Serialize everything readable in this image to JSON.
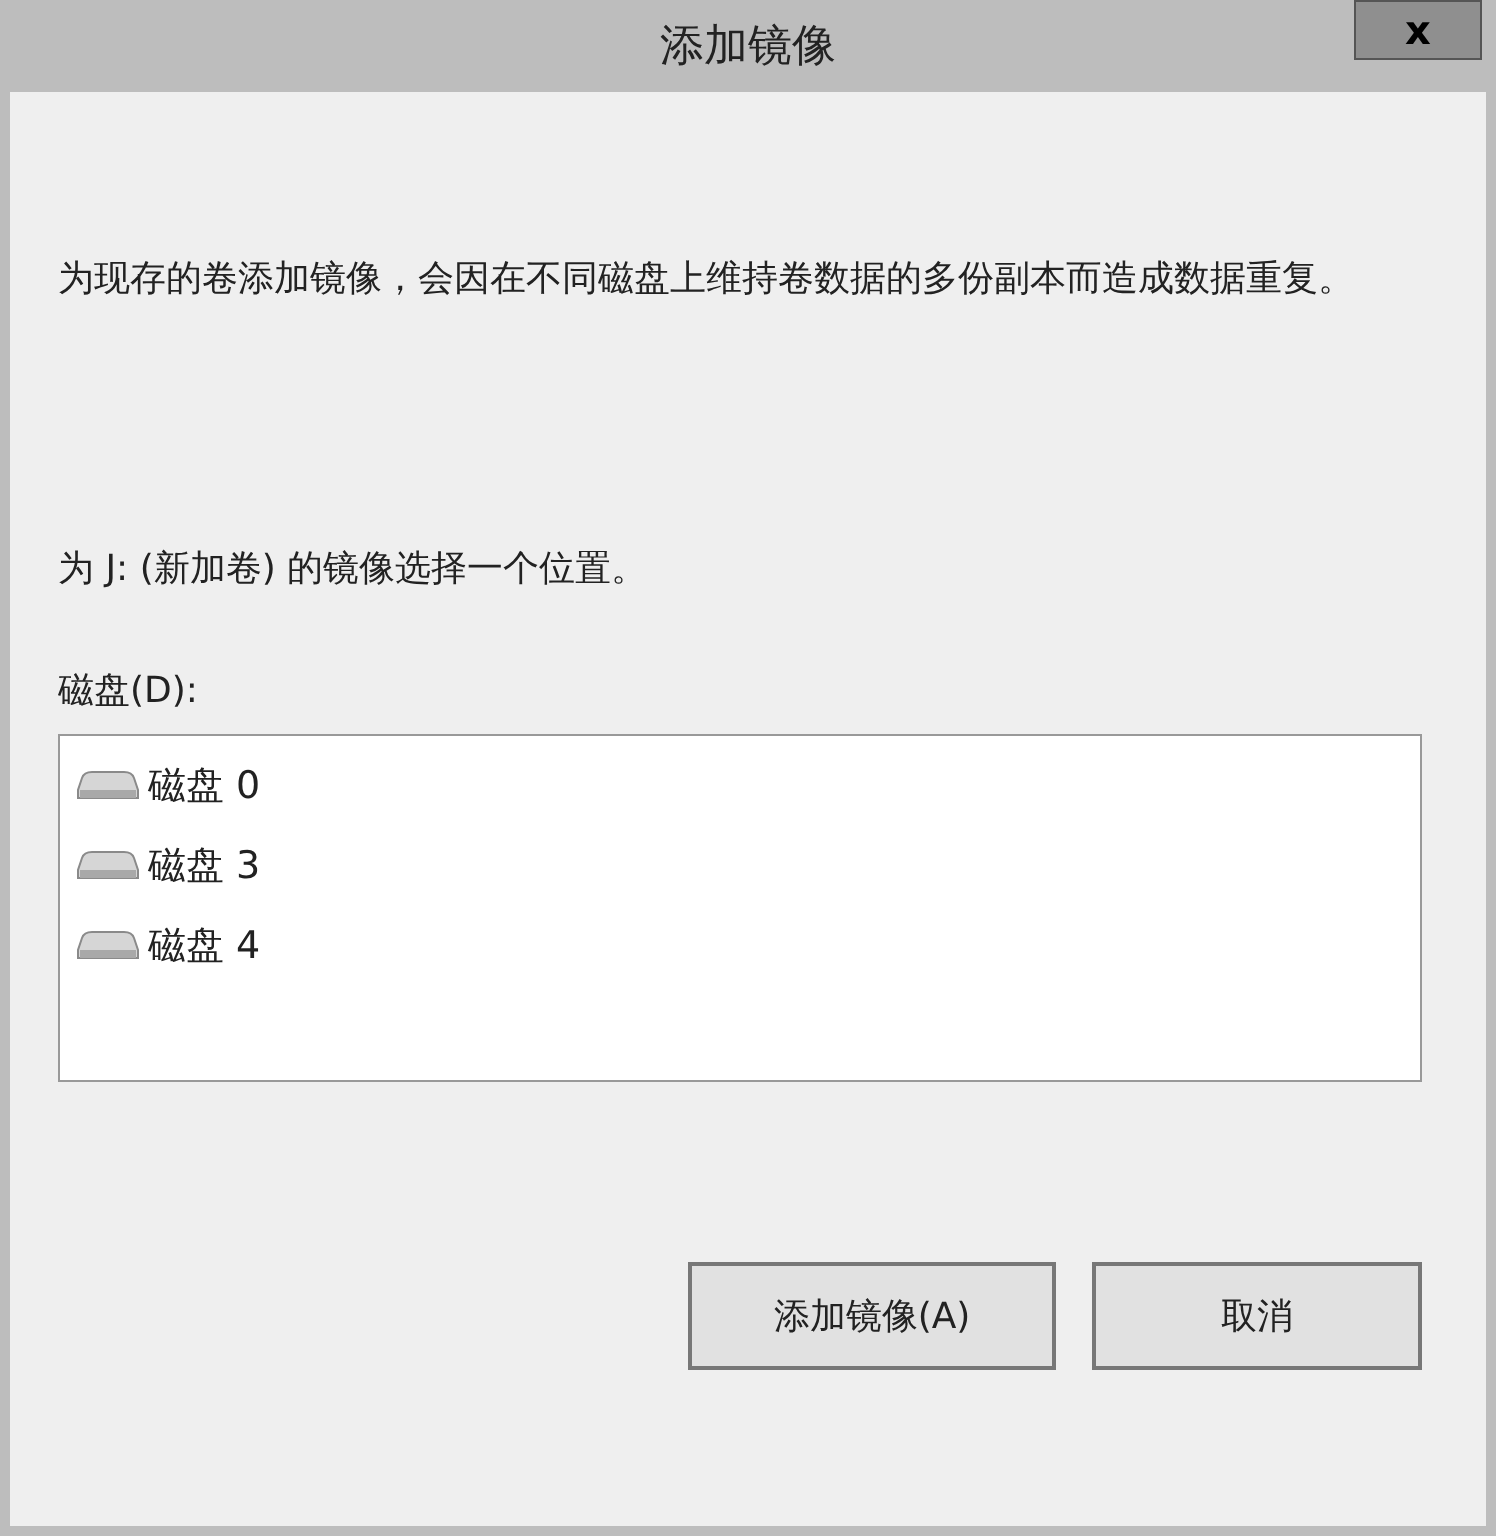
{
  "window": {
    "title": "添加镜像",
    "close": "x"
  },
  "description": "为现存的卷添加镜像，会因在不同磁盘上维持卷数据的多份副本而造成数据重复。",
  "prompt": "为 J: (新加卷) 的镜像选择一个位置。",
  "disk_list": {
    "label": "磁盘(D):",
    "items": [
      {
        "name": "磁盘 0"
      },
      {
        "name": "磁盘 3"
      },
      {
        "name": "磁盘 4"
      }
    ]
  },
  "buttons": [
    "添加镜像(A)",
    "取消"
  ]
}
